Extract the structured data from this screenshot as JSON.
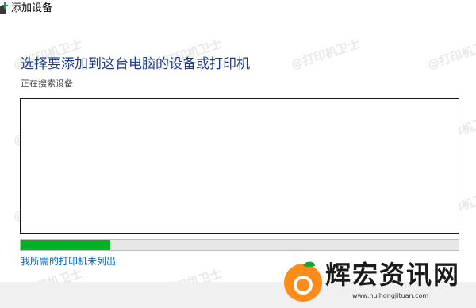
{
  "window": {
    "title": "添加设备",
    "icon": "add-device-icon"
  },
  "main": {
    "heading": "选择要添加到这台电脑的设备或打印机",
    "subheading": "正在搜索设备",
    "progress": 0.205,
    "printer_link": "我所需的打印机未列出"
  },
  "watermark": {
    "text": "@打印机卫士"
  },
  "brand": {
    "name": "辉宏资讯网",
    "url": "www.huihongjituan.com"
  },
  "colors": {
    "heading": "#1e3a8a",
    "link": "#0066cc",
    "progress": "#06b025",
    "footer": "#f0f0f0"
  }
}
